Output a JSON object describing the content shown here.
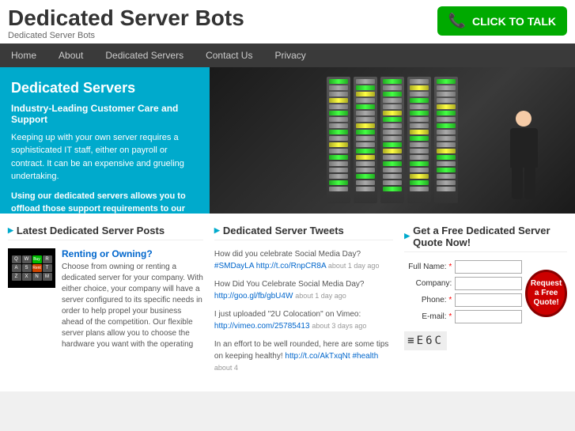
{
  "header": {
    "site_title": "Dedicated Server Bots",
    "site_subtitle": "Dedicated Server Bots",
    "cta_label": "CLICK TO TALK"
  },
  "nav": {
    "items": [
      {
        "label": "Home",
        "active": false
      },
      {
        "label": "About",
        "active": false
      },
      {
        "label": "Dedicated Servers",
        "active": false
      },
      {
        "label": "Contact Us",
        "active": false
      },
      {
        "label": "Privacy",
        "active": false
      }
    ]
  },
  "hero": {
    "title": "Dedicated Servers",
    "subtitle": "Industry-Leading Customer Care and Support",
    "body1": "Keeping up with your own server requires a sophisticated IT staff, either on payroll or contract. It can be an expensive and grueling undertaking.",
    "body2": "Using our dedicated servers allows you to offload those support requirements to our expert support staff."
  },
  "posts": {
    "title": "Latest Dedicated Server Posts",
    "items": [
      {
        "title": "Renting or Owning?",
        "body": "Choose from owning or renting a dedicated server for your company. With either choice, your company will have a server configured to its specific needs in order to help propel your business ahead of the competition. Our flexible server plans allow you to choose the hardware you want with the operating"
      }
    ]
  },
  "tweets": {
    "title": "Dedicated Server Tweets",
    "items": [
      {
        "text": "How did you celebrate Social Media Day?",
        "hashtags": "#SMDayLA",
        "link": "http://t.co/RnpCR8A",
        "meta": "about 1 day ago"
      },
      {
        "text": "How Did You Celebrate Social Media Day?",
        "link": "http://goo.gl/fb/gbU4W",
        "meta": "about 1 day ago"
      },
      {
        "text": "I just uploaded \"2U Colocation\" on Vimeo:",
        "link": "http://vimeo.com/25785413",
        "meta": "about 3 days ago"
      },
      {
        "text": "In an effort to be well rounded, here are some tips on keeping healthy!",
        "link": "http://t.co/AkTxqNt",
        "hashtag2": "#health",
        "meta": "about 4"
      }
    ]
  },
  "quote": {
    "title": "Get a Free Dedicated Server Quote Now!",
    "fields": [
      {
        "label": "Full Name:",
        "required": true,
        "name": "fullname"
      },
      {
        "label": "Company:",
        "required": false,
        "name": "company"
      },
      {
        "label": "Phone:",
        "required": true,
        "name": "phone"
      },
      {
        "label": "E-mail:",
        "required": true,
        "name": "email"
      }
    ],
    "button_label": "Request a Free Quote!",
    "captcha": "≡E6C"
  }
}
